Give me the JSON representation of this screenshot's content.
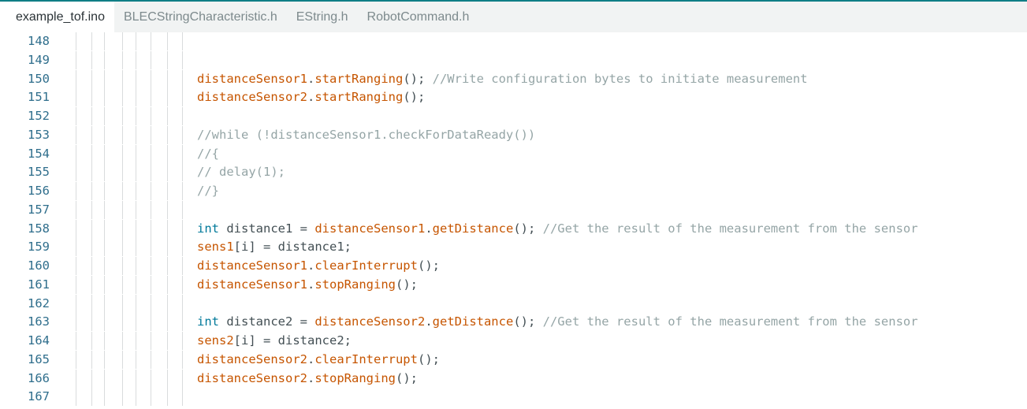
{
  "tabs": [
    {
      "label": "example_tof.ino",
      "active": true
    },
    {
      "label": "BLECStringCharacteristic.h",
      "active": false
    },
    {
      "label": "EString.h",
      "active": false
    },
    {
      "label": "RobotCommand.h",
      "active": false
    }
  ],
  "colors": {
    "accent": "#0f7e86",
    "line_number": "#2f6e8c",
    "function": "#c65500",
    "keyword": "#00799a",
    "comment": "#95a5a6",
    "text": "#434f54"
  },
  "editor": {
    "lines": [
      {
        "num": "148",
        "tokens": []
      },
      {
        "num": "149",
        "tokens": []
      },
      {
        "num": "150",
        "tokens": [
          {
            "t": "fn",
            "v": "distanceSensor1"
          },
          {
            "t": "tx",
            "v": "."
          },
          {
            "t": "fn",
            "v": "startRanging"
          },
          {
            "t": "tx",
            "v": "(); "
          },
          {
            "t": "cm",
            "v": "//Write configuration bytes to initiate measurement"
          }
        ]
      },
      {
        "num": "151",
        "tokens": [
          {
            "t": "fn",
            "v": "distanceSensor2"
          },
          {
            "t": "tx",
            "v": "."
          },
          {
            "t": "fn",
            "v": "startRanging"
          },
          {
            "t": "tx",
            "v": "();"
          }
        ]
      },
      {
        "num": "152",
        "tokens": []
      },
      {
        "num": "153",
        "tokens": [
          {
            "t": "cm",
            "v": "//while (!distanceSensor1.checkForDataReady())"
          }
        ]
      },
      {
        "num": "154",
        "tokens": [
          {
            "t": "cm",
            "v": "//{"
          }
        ]
      },
      {
        "num": "155",
        "tokens": [
          {
            "t": "cm",
            "v": "// delay(1);"
          }
        ]
      },
      {
        "num": "156",
        "tokens": [
          {
            "t": "cm",
            "v": "//}"
          }
        ]
      },
      {
        "num": "157",
        "tokens": []
      },
      {
        "num": "158",
        "tokens": [
          {
            "t": "kw",
            "v": "int"
          },
          {
            "t": "tx",
            "v": " distance1 = "
          },
          {
            "t": "fn",
            "v": "distanceSensor1"
          },
          {
            "t": "tx",
            "v": "."
          },
          {
            "t": "fn",
            "v": "getDistance"
          },
          {
            "t": "tx",
            "v": "(); "
          },
          {
            "t": "cm",
            "v": "//Get the result of the measurement from the sensor"
          }
        ]
      },
      {
        "num": "159",
        "tokens": [
          {
            "t": "fn",
            "v": "sens1"
          },
          {
            "t": "tx",
            "v": "[i] = distance1;"
          }
        ]
      },
      {
        "num": "160",
        "tokens": [
          {
            "t": "fn",
            "v": "distanceSensor1"
          },
          {
            "t": "tx",
            "v": "."
          },
          {
            "t": "fn",
            "v": "clearInterrupt"
          },
          {
            "t": "tx",
            "v": "();"
          }
        ]
      },
      {
        "num": "161",
        "tokens": [
          {
            "t": "fn",
            "v": "distanceSensor1"
          },
          {
            "t": "tx",
            "v": "."
          },
          {
            "t": "fn",
            "v": "stopRanging"
          },
          {
            "t": "tx",
            "v": "();"
          }
        ]
      },
      {
        "num": "162",
        "tokens": []
      },
      {
        "num": "163",
        "tokens": [
          {
            "t": "kw",
            "v": "int"
          },
          {
            "t": "tx",
            "v": " distance2 = "
          },
          {
            "t": "fn",
            "v": "distanceSensor2"
          },
          {
            "t": "tx",
            "v": "."
          },
          {
            "t": "fn",
            "v": "getDistance"
          },
          {
            "t": "tx",
            "v": "(); "
          },
          {
            "t": "cm",
            "v": "//Get the result of the measurement from the sensor"
          }
        ]
      },
      {
        "num": "164",
        "tokens": [
          {
            "t": "fn",
            "v": "sens2"
          },
          {
            "t": "tx",
            "v": "[i] = distance2;"
          }
        ]
      },
      {
        "num": "165",
        "tokens": [
          {
            "t": "fn",
            "v": "distanceSensor2"
          },
          {
            "t": "tx",
            "v": "."
          },
          {
            "t": "fn",
            "v": "clearInterrupt"
          },
          {
            "t": "tx",
            "v": "();"
          }
        ]
      },
      {
        "num": "166",
        "tokens": [
          {
            "t": "fn",
            "v": "distanceSensor2"
          },
          {
            "t": "tx",
            "v": "."
          },
          {
            "t": "fn",
            "v": "stopRanging"
          },
          {
            "t": "tx",
            "v": "();"
          }
        ]
      },
      {
        "num": "167",
        "tokens": []
      }
    ]
  }
}
